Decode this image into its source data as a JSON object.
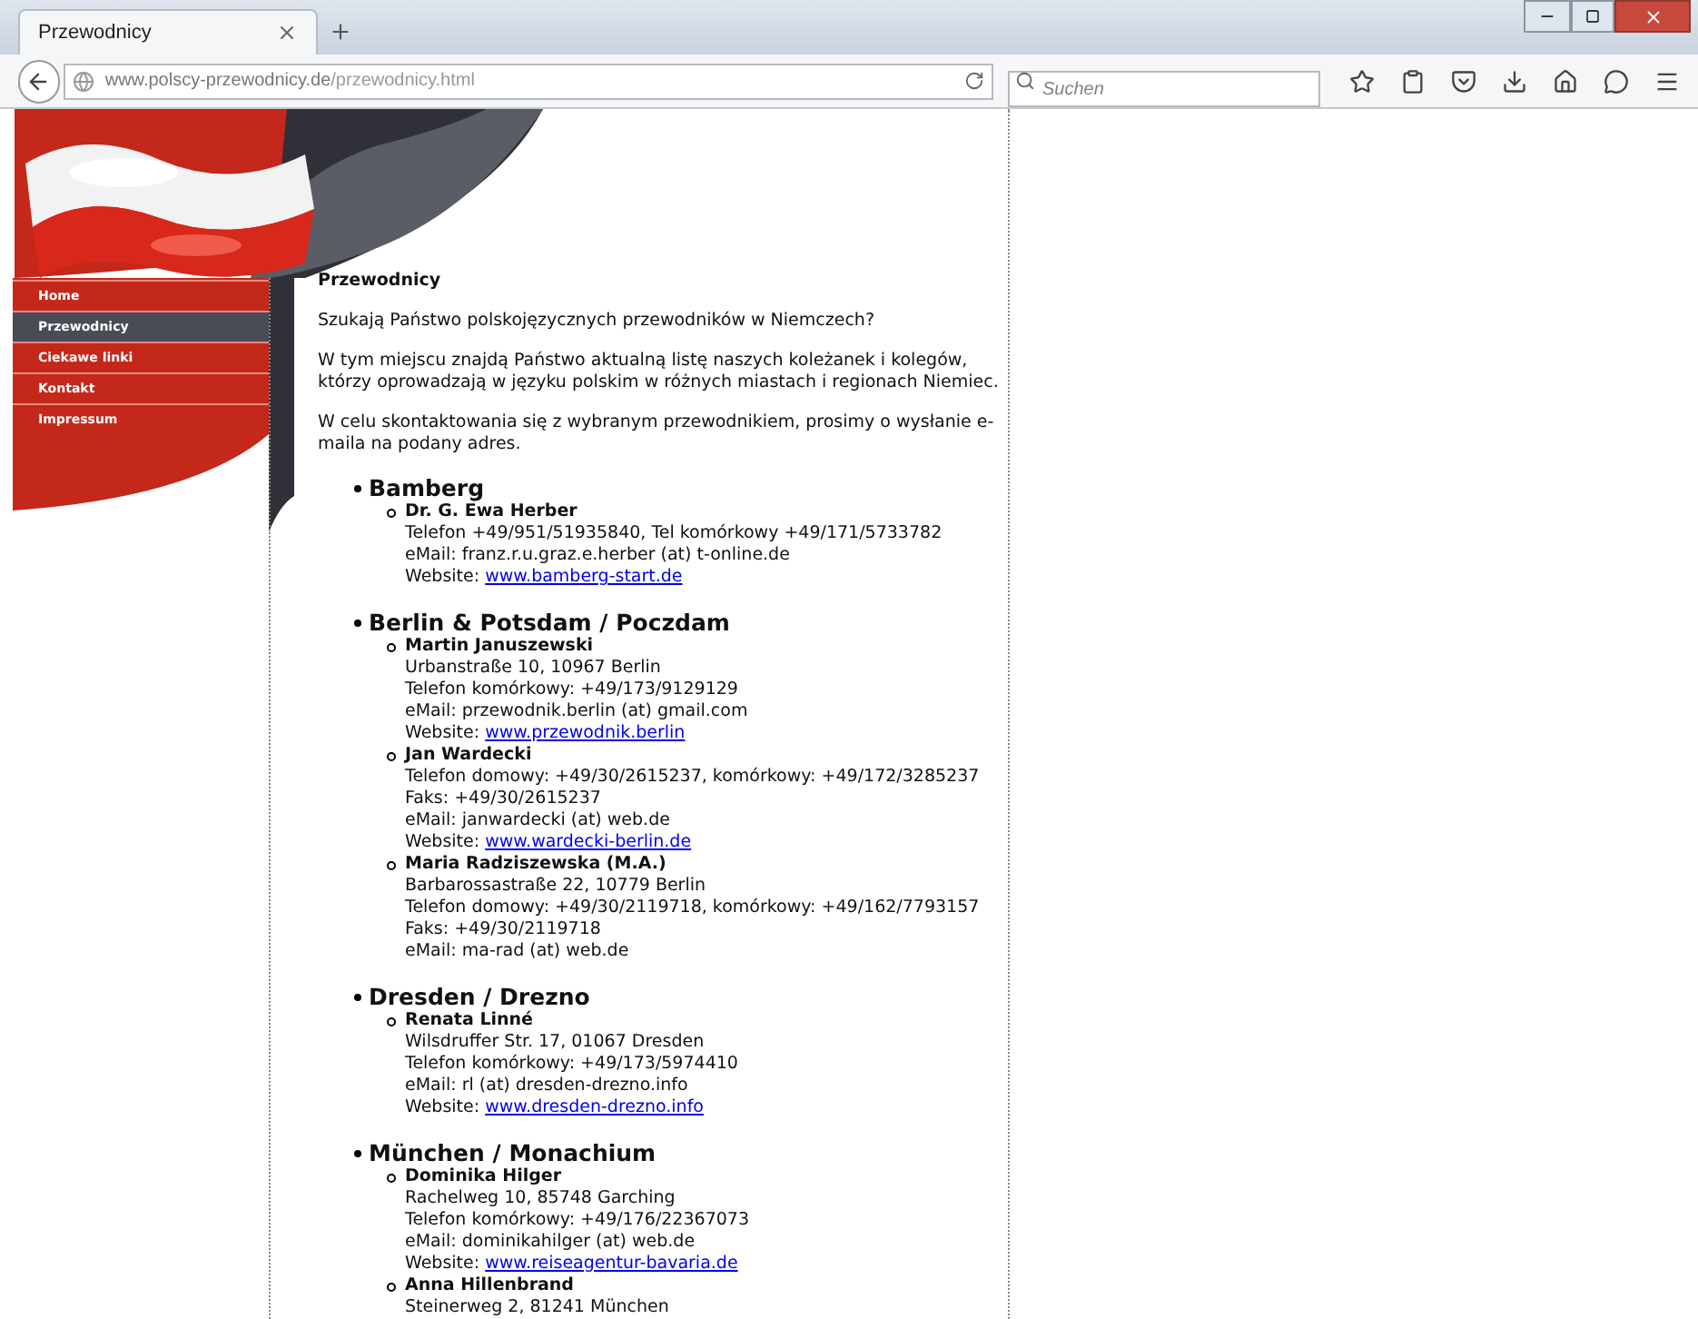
{
  "browser": {
    "tab_title": "Przewodnicy",
    "url_domain": "www.polscy-przewodnicy.de",
    "url_path": "/przewodnicy.html",
    "search_placeholder": "Suchen"
  },
  "nav": [
    {
      "label": "Home",
      "selected": false
    },
    {
      "label": "Przewodnicy",
      "selected": true
    },
    {
      "label": "Ciekawe linki",
      "selected": false
    },
    {
      "label": "Kontakt",
      "selected": false
    },
    {
      "label": "Impressum",
      "selected": false
    }
  ],
  "content": {
    "title": "Przewodnicy",
    "paragraphs": [
      "Szukają Państwo polskojęzycznych przewodników w Niemczech?",
      "W tym miejscu znajdą Państwo aktualną listę naszych koleżanek i kolegów, którzy oprowadzają w języku polskim w różnych miastach i regionach Niemiec.",
      "W celu skontaktowania się z wybranym przewodnikiem, prosimy o wysłanie e-maila na podany adres."
    ],
    "cities": [
      {
        "name": "Bamberg",
        "guides": [
          {
            "name": "Dr. G. Ewa Herber",
            "lines": [
              {
                "kind": "text",
                "text": "Telefon +49/951/51935840, Tel komórkowy +49/171/5733782"
              },
              {
                "kind": "text",
                "text": "eMail: franz.r.u.graz.e.herber (at) t-online.de"
              },
              {
                "kind": "link",
                "label": "Website:",
                "link": "www.bamberg-start.de"
              }
            ]
          }
        ]
      },
      {
        "name": "Berlin & Potsdam / Poczdam",
        "guides": [
          {
            "name": "Martin Januszewski",
            "lines": [
              {
                "kind": "text",
                "text": "Urbanstraße 10, 10967 Berlin"
              },
              {
                "kind": "text",
                "text": "Telefon komórkowy: +49/173/9129129"
              },
              {
                "kind": "text",
                "text": "eMail: przewodnik.berlin (at) gmail.com"
              },
              {
                "kind": "link",
                "label": "Website:",
                "link": "www.przewodnik.berlin"
              }
            ]
          },
          {
            "name": "Jan Wardecki",
            "lines": [
              {
                "kind": "text",
                "text": "Telefon domowy: +49/30/2615237, komórkowy: +49/172/3285237"
              },
              {
                "kind": "text",
                "text": "Faks: +49/30/2615237"
              },
              {
                "kind": "text",
                "text": "eMail: janwardecki (at) web.de"
              },
              {
                "kind": "link",
                "label": "Website:",
                "link": "www.wardecki-berlin.de"
              }
            ]
          },
          {
            "name": "Maria Radziszewska (M.A.)",
            "lines": [
              {
                "kind": "text",
                "text": "Barbarossastraße 22, 10779 Berlin"
              },
              {
                "kind": "text",
                "text": "Telefon domowy: +49/30/2119718, komórkowy: +49/162/7793157"
              },
              {
                "kind": "text",
                "text": "Faks: +49/30/2119718"
              },
              {
                "kind": "text",
                "text": "eMail: ma-rad (at) web.de"
              }
            ]
          }
        ]
      },
      {
        "name": "Dresden / Drezno",
        "guides": [
          {
            "name": "Renata Linné",
            "lines": [
              {
                "kind": "text",
                "text": "Wilsdruffer Str. 17, 01067 Dresden"
              },
              {
                "kind": "text",
                "text": "Telefon komórkowy: +49/173/5974410"
              },
              {
                "kind": "text",
                "text": "eMail: rl (at) dresden-drezno.info"
              },
              {
                "kind": "link",
                "label": "Website:",
                "link": "www.dresden-drezno.info"
              }
            ]
          }
        ]
      },
      {
        "name": "München / Monachium",
        "guides": [
          {
            "name": "Dominika Hilger",
            "lines": [
              {
                "kind": "text",
                "text": "Rachelweg 10, 85748 Garching"
              },
              {
                "kind": "text",
                "text": "Telefon komórkowy: +49/176/22367073"
              },
              {
                "kind": "text",
                "text": "eMail: dominikahilger (at) web.de"
              },
              {
                "kind": "link",
                "label": "Website:",
                "link": "www.reiseagentur-bavaria.de"
              }
            ]
          },
          {
            "name": "Anna Hillenbrand",
            "lines": [
              {
                "kind": "text",
                "text": "Steinerweg 2, 81241 München"
              }
            ]
          }
        ]
      }
    ]
  }
}
